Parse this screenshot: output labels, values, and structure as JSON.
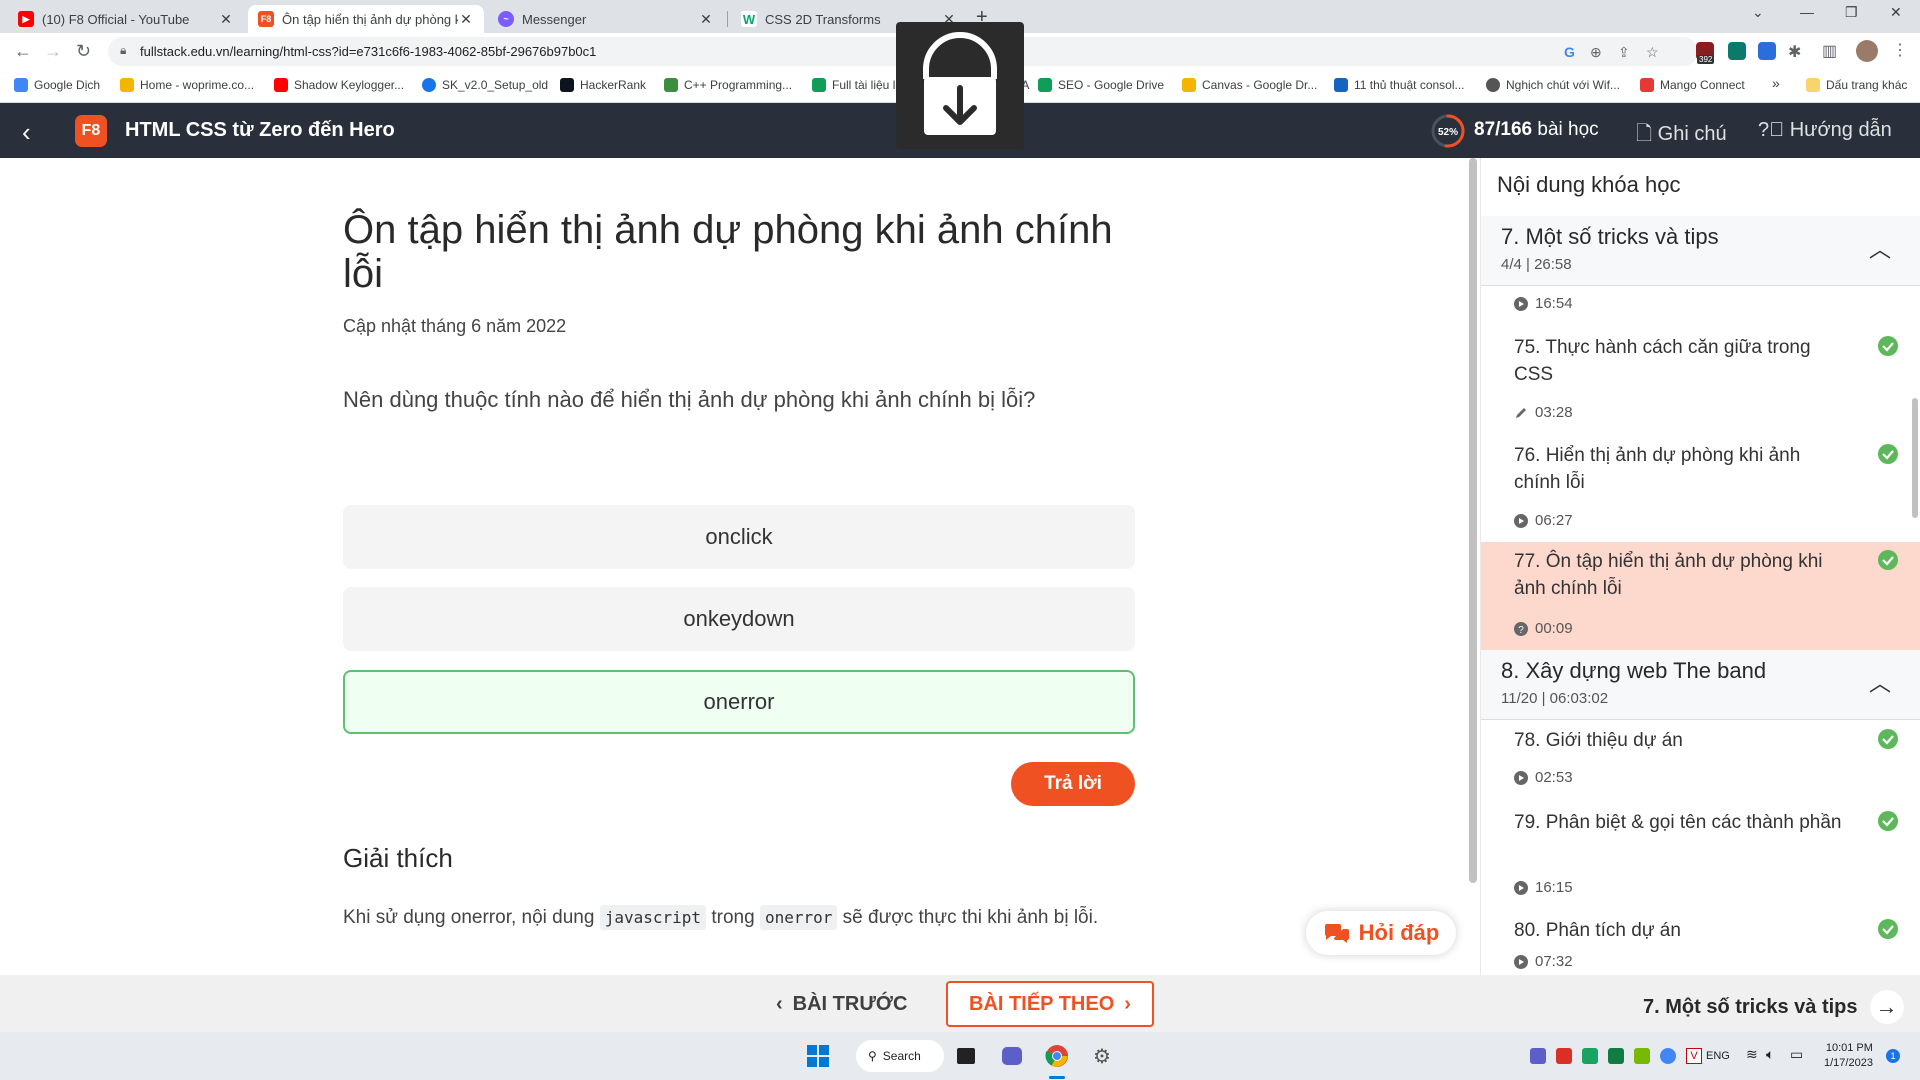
{
  "browser": {
    "tabs": [
      {
        "title": "(10) F8 Official - YouTube",
        "favicon": "youtube-icon",
        "color": "#ff0000"
      },
      {
        "title": "Ôn tập hiển thị ảnh dự phòng kh",
        "favicon": "f8-icon",
        "color": "#f05123"
      },
      {
        "title": "Messenger",
        "favicon": "messenger-icon",
        "color": "#7b5cff"
      },
      {
        "title": "CSS 2D Transforms",
        "favicon": "w3schools-icon",
        "color": "#04aa6d"
      }
    ],
    "url": "fullstack.edu.vn/learning/html-css?id=e731c6f6-1983-4062-85bf-29676b97b0c1",
    "ext_badge": "392",
    "bookmarks": [
      {
        "label": "Google Dịch",
        "color": "#4285f4"
      },
      {
        "label": "Home - woprime.co...",
        "color": "#f4b400"
      },
      {
        "label": "Shadow Keylogger...",
        "color": "#ff0000"
      },
      {
        "label": "SK_v2.0_Setup_old",
        "color": "#1a73e8"
      },
      {
        "label": "HackerRank",
        "color": "#1ba94c"
      },
      {
        "label": "C++ Programming...",
        "color": "#3c8d40"
      },
      {
        "label": "Full tài liệu lập tr",
        "color": "#0f9d58"
      },
      {
        "label": "MEGA",
        "color": "#d9272e"
      },
      {
        "label": "SEO - Google Drive",
        "color": "#0f9d58"
      },
      {
        "label": "Canvas - Google Dr...",
        "color": "#f4b400"
      },
      {
        "label": "11 thủ thuật consol...",
        "color": "#1565c0"
      },
      {
        "label": "Nghịch chút với Wif...",
        "color": "#555555"
      },
      {
        "label": "Mango Connect",
        "color": "#e53935"
      }
    ],
    "bookmarks_more": "»",
    "bookmarks_folder": "Dấu trang khác"
  },
  "header": {
    "back_icon": "chevron-left-icon",
    "logo": "F8",
    "course_title": "HTML CSS từ Zero đến Hero",
    "progress_percent": 52,
    "progress_percent_label": "52%",
    "progress_count": "87/166",
    "progress_unit": "bài học",
    "notes_label": "Ghi chú",
    "guide_label": "Hướng dẫn"
  },
  "question": {
    "title": "Ôn tập hiển thị ảnh dự phòng khi ảnh chính lỗi",
    "updated": "Cập nhật tháng 6 năm 2022",
    "text": "Nên dùng thuộc tính nào để hiển thị ảnh dự phòng khi ảnh chính bị lỗi?",
    "answers": [
      "onclick",
      "onkeydown",
      "onerror"
    ],
    "selected_answer_index": 2,
    "reply_label": "Trả lời"
  },
  "explanation": {
    "heading": "Giải thích",
    "part1": "Khi sử dụng onerror, nội dung",
    "code1": "javascript",
    "part2": "trong",
    "code2": "onerror",
    "part3": "sẽ được thực thi khi ảnh bị lỗi."
  },
  "qa_button": "Hỏi đáp",
  "sidebar": {
    "title": "Nội dung khóa học",
    "section7": {
      "name": "7. Một số tricks và tips",
      "meta": "4/4 | 26:58"
    },
    "section7_first_meta": "16:54",
    "section7_lessons": [
      {
        "name": "75. Thực hành cách căn giữa trong CSS",
        "meta": "03:28",
        "meta_icon": "pencil-icon",
        "done": true
      },
      {
        "name": "76. Hiển thị ảnh dự phòng khi ảnh chính lỗi",
        "meta": "06:27",
        "meta_icon": "play-circle-icon",
        "done": true
      },
      {
        "name": "77. Ôn tập hiển thị ảnh dự phòng khi ảnh chính lỗi",
        "meta": "00:09",
        "meta_icon": "question-circle-icon",
        "done": true,
        "active": true
      }
    ],
    "section8": {
      "name": "8. Xây dựng web The band",
      "meta": "11/20 | 06:03:02"
    },
    "section8_lessons": [
      {
        "name": "78. Giới thiệu dự án",
        "meta": "02:53",
        "meta_icon": "play-circle-icon",
        "done": true
      },
      {
        "name": "79. Phân biệt & gọi tên các thành phần",
        "meta": "16:15",
        "meta_icon": "play-circle-icon",
        "done": true
      },
      {
        "name": "80. Phân tích dự án",
        "meta": "07:32",
        "meta_icon": "play-circle-icon",
        "done": true
      }
    ]
  },
  "bottom_nav": {
    "prev_label": "BÀI TRƯỚC",
    "next_label": "BÀI TIẾP THEO",
    "section_label": "7. Một số tricks và tips"
  },
  "taskbar": {
    "search_label": "Search",
    "lang": "ENG",
    "time": "10:01 PM",
    "date": "1/17/2023",
    "notification_count": "1"
  },
  "colors": {
    "brand": "#f05123",
    "header_bg": "#29303b",
    "done_green": "#5db85b",
    "active_lesson_bg": "#fcd8cd"
  }
}
